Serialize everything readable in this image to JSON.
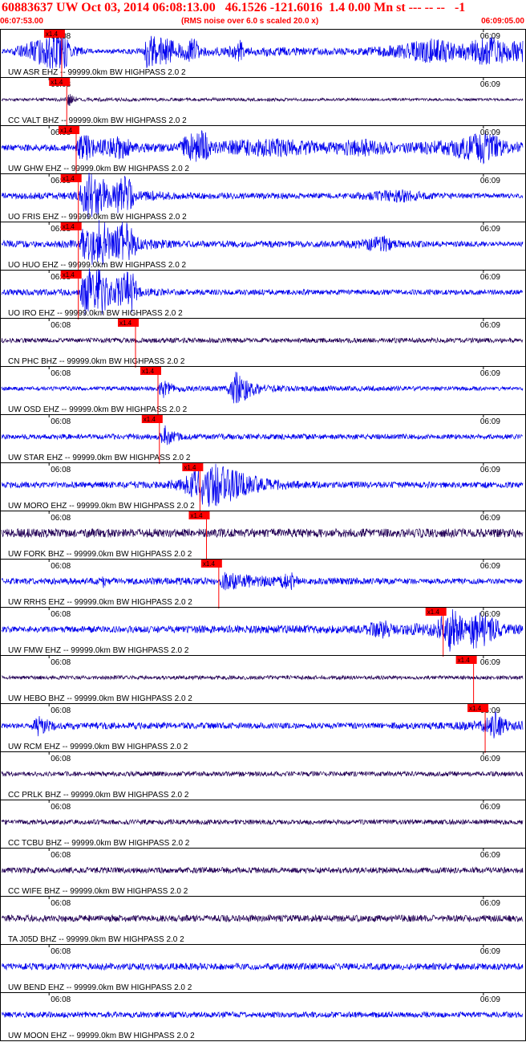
{
  "header": {
    "title": "60883637 UW Oct 03, 2014 06:08:13.00   46.1526 -121.6016  1.4 0.00 Mn st --- -- --   -1",
    "start_time": "06:07:53.00",
    "rms_note": "(RMS noise over 6.0 s scaled 20.0 x)",
    "end_time": "06:09:05.00"
  },
  "colors": {
    "header_text": "#ff0000",
    "ehz_trace": "#0000ee",
    "bhz_trace": "#220055",
    "pick": "#ff0000",
    "frame": "#000000"
  },
  "chart_data": {
    "type": "line",
    "x_range": [
      "06:07:53.00",
      "06:09:05.00"
    ],
    "tick_labels": [
      "06:08",
      "06:09"
    ],
    "pick_label": "x1.4",
    "series": [
      {
        "name": "UW ASR EHZ -- 99999.0km BW  HIGHPASS  2.0  2",
        "station": "ASR",
        "channel": "EHZ",
        "pick_sec": 8.3,
        "envelope": [
          [
            1,
            10
          ],
          [
            8.5,
            90
          ],
          [
            9.5,
            28
          ],
          [
            12,
            10
          ],
          [
            19.5,
            12
          ],
          [
            20,
            70
          ],
          [
            23,
            55
          ],
          [
            25,
            30
          ],
          [
            26.5,
            62
          ],
          [
            27.5,
            20
          ],
          [
            31,
            18
          ],
          [
            33,
            50
          ],
          [
            34,
            15
          ],
          [
            36.5,
            22
          ],
          [
            41,
            16
          ],
          [
            49,
            14
          ],
          [
            55,
            28
          ],
          [
            60,
            60
          ],
          [
            63,
            30
          ],
          [
            66,
            55
          ],
          [
            68,
            60
          ],
          [
            70,
            45
          ]
        ]
      },
      {
        "name": "CC VALT BHZ -- 99999.0km BW  HIGHPASS  2.0  2",
        "station": "VALT",
        "channel": "BHZ",
        "pick_sec": 9.0,
        "envelope": [
          [
            1,
            5
          ],
          [
            9,
            8
          ],
          [
            9.3,
            35
          ],
          [
            10.5,
            8
          ],
          [
            70,
            5
          ]
        ]
      },
      {
        "name": "UW GHW EHZ -- 99999.0km BW  HIGHPASS  2.0  2",
        "station": "GHW",
        "channel": "EHZ",
        "pick_sec": 10.3,
        "envelope": [
          [
            1,
            12
          ],
          [
            10.3,
            14
          ],
          [
            11,
            70
          ],
          [
            13,
            30
          ],
          [
            17,
            55
          ],
          [
            18,
            20
          ],
          [
            24,
            18
          ],
          [
            26,
            60
          ],
          [
            28,
            75
          ],
          [
            29,
            25
          ],
          [
            33,
            35
          ],
          [
            38,
            40
          ],
          [
            45,
            25
          ],
          [
            50,
            38
          ],
          [
            55,
            20
          ],
          [
            60,
            30
          ],
          [
            63,
            45
          ],
          [
            67,
            70
          ],
          [
            70,
            25
          ]
        ]
      },
      {
        "name": "UO FRIS EHZ -- 99999.0km BW  HIGHPASS  2.0  2",
        "station": "FRIS",
        "channel": "EHZ",
        "pick_sec": 10.6,
        "envelope": [
          [
            1,
            14
          ],
          [
            10.6,
            16
          ],
          [
            11.5,
            100
          ],
          [
            13.5,
            100
          ],
          [
            15,
            40
          ],
          [
            16,
            90
          ],
          [
            17.5,
            80
          ],
          [
            18.5,
            25
          ],
          [
            25,
            14
          ],
          [
            48,
            12
          ],
          [
            52,
            22
          ],
          [
            55,
            30
          ],
          [
            60,
            12
          ],
          [
            70,
            10
          ]
        ]
      },
      {
        "name": "UO HUO EHZ -- 99999.0km BW  HIGHPASS  2.0  2",
        "station": "HUO",
        "channel": "EHZ",
        "pick_sec": 10.6,
        "envelope": [
          [
            1,
            14
          ],
          [
            10.6,
            16
          ],
          [
            11.5,
            100
          ],
          [
            14,
            100
          ],
          [
            15.5,
            50
          ],
          [
            16.5,
            100
          ],
          [
            18,
            80
          ],
          [
            19,
            25
          ],
          [
            25,
            14
          ],
          [
            46,
            14
          ],
          [
            50,
            22
          ],
          [
            53,
            40
          ],
          [
            54,
            18
          ],
          [
            60,
            12
          ],
          [
            70,
            10
          ]
        ]
      },
      {
        "name": "UO IRO EHZ -- 99999.0km BW  HIGHPASS  2.0  2",
        "station": "IRO",
        "channel": "EHZ",
        "pick_sec": 10.6,
        "envelope": [
          [
            1,
            12
          ],
          [
            10.6,
            14
          ],
          [
            11.5,
            100
          ],
          [
            14,
            100
          ],
          [
            15.5,
            40
          ],
          [
            16.5,
            95
          ],
          [
            18,
            90
          ],
          [
            19,
            20
          ],
          [
            25,
            12
          ],
          [
            70,
            10
          ]
        ]
      },
      {
        "name": "CN PHC BHZ -- 99999.0km BW  HIGHPASS  2.0  2",
        "station": "PHC",
        "channel": "BHZ",
        "pick_sec": 18.5,
        "envelope": [
          [
            1,
            10
          ],
          [
            70,
            10
          ]
        ]
      },
      {
        "name": "UW OSD EHZ -- 99999.0km BW  HIGHPASS  2.0  2",
        "station": "OSD",
        "channel": "EHZ",
        "pick_sec": 21.6,
        "envelope": [
          [
            1,
            8
          ],
          [
            21.6,
            9
          ],
          [
            22.2,
            45
          ],
          [
            24,
            15
          ],
          [
            28,
            10
          ],
          [
            31,
            12
          ],
          [
            32.4,
            80
          ],
          [
            34,
            40
          ],
          [
            36,
            18
          ],
          [
            40,
            12
          ],
          [
            70,
            8
          ]
        ]
      },
      {
        "name": "UW STAR EHZ -- 99999.0km BW  HIGHPASS  2.0  2",
        "station": "STAR",
        "channel": "EHZ",
        "pick_sec": 21.8,
        "envelope": [
          [
            1,
            10
          ],
          [
            21.8,
            12
          ],
          [
            22.3,
            60
          ],
          [
            23.5,
            25
          ],
          [
            25,
            12
          ],
          [
            70,
            10
          ]
        ]
      },
      {
        "name": "UW MORO EHZ -- 99999.0km BW  HIGHPASS  2.0  2",
        "station": "MORO",
        "channel": "EHZ",
        "pick_sec": 27.4,
        "envelope": [
          [
            1,
            12
          ],
          [
            22,
            14
          ],
          [
            25,
            30
          ],
          [
            27,
            70
          ],
          [
            28.5,
            100
          ],
          [
            31,
            75
          ],
          [
            34,
            45
          ],
          [
            37,
            25
          ],
          [
            42,
            14
          ],
          [
            70,
            12
          ]
        ]
      },
      {
        "name": "UW FORK BHZ -- 99999.0km BW  HIGHPASS  2.0  2",
        "station": "FORK",
        "channel": "BHZ",
        "pick_sec": 28.3,
        "envelope": [
          [
            1,
            18
          ],
          [
            70,
            18
          ]
        ]
      },
      {
        "name": "UW RRHS EHZ -- 99999.0km BW  HIGHPASS  2.0  2",
        "station": "RRHS",
        "channel": "EHZ",
        "pick_sec": 30.0,
        "envelope": [
          [
            1,
            12
          ],
          [
            13.8,
            14
          ],
          [
            14,
            45
          ],
          [
            14.4,
            14
          ],
          [
            30,
            15
          ],
          [
            30.8,
            40
          ],
          [
            33,
            30
          ],
          [
            38,
            20
          ],
          [
            40,
            40
          ],
          [
            41,
            15
          ],
          [
            70,
            10
          ]
        ]
      },
      {
        "name": "UW FMW EHZ -- 99999.0km BW  HIGHPASS  2.0  2",
        "station": "FMW",
        "channel": "EHZ",
        "pick_sec": 61.0,
        "envelope": [
          [
            1,
            12
          ],
          [
            50,
            18
          ],
          [
            53,
            50
          ],
          [
            54,
            20
          ],
          [
            60,
            30
          ],
          [
            62,
            100
          ],
          [
            64,
            40
          ],
          [
            65.5,
            90
          ],
          [
            67,
            70
          ],
          [
            69,
            30
          ],
          [
            70,
            20
          ]
        ]
      },
      {
        "name": "UW HEBO BHZ -- 99999.0km BW  HIGHPASS  2.0  2",
        "station": "HEBO",
        "channel": "BHZ",
        "pick_sec": 65.2,
        "envelope": [
          [
            1,
            8
          ],
          [
            70,
            8
          ]
        ]
      },
      {
        "name": "UW RCM EHZ -- 99999.0km BW  HIGHPASS  2.0  2",
        "station": "RCM",
        "channel": "EHZ",
        "pick_sec": 66.8,
        "envelope": [
          [
            1,
            10
          ],
          [
            4,
            10
          ],
          [
            5,
            45
          ],
          [
            6,
            30
          ],
          [
            8,
            15
          ],
          [
            40,
            12
          ],
          [
            60,
            14
          ],
          [
            66,
            20
          ],
          [
            68.3,
            60
          ],
          [
            70,
            20
          ]
        ]
      },
      {
        "name": "CC PRLK BHZ -- 99999.0km BW  HIGHPASS  2.0  2",
        "station": "PRLK",
        "channel": "BHZ",
        "pick_sec": null,
        "envelope": [
          [
            1,
            10
          ],
          [
            70,
            10
          ]
        ]
      },
      {
        "name": "CC TCBU BHZ -- 99999.0km BW  HIGHPASS  2.0  2",
        "station": "TCBU",
        "channel": "BHZ",
        "pick_sec": null,
        "envelope": [
          [
            1,
            10
          ],
          [
            70,
            10
          ]
        ]
      },
      {
        "name": "CC WIFE BHZ -- 99999.0km BW  HIGHPASS  2.0  2",
        "station": "WIFE",
        "channel": "BHZ",
        "pick_sec": null,
        "envelope": [
          [
            1,
            12
          ],
          [
            70,
            12
          ]
        ]
      },
      {
        "name": "TA J05D BHZ -- 99999.0km BW  HIGHPASS  2.0  2",
        "station": "J05D",
        "channel": "BHZ",
        "pick_sec": null,
        "envelope": [
          [
            1,
            14
          ],
          [
            70,
            14
          ]
        ]
      },
      {
        "name": "UW BEND EHZ -- 99999.0km BW  HIGHPASS  2.0  2",
        "station": "BEND",
        "channel": "EHZ",
        "pick_sec": null,
        "envelope": [
          [
            1,
            14
          ],
          [
            70,
            14
          ]
        ]
      },
      {
        "name": "UW MOON EHZ -- 99999.0km BW  HIGHPASS  2.0  2",
        "station": "MOON",
        "channel": "EHZ",
        "pick_sec": null,
        "envelope": [
          [
            1,
            12
          ],
          [
            70,
            12
          ]
        ]
      }
    ]
  }
}
